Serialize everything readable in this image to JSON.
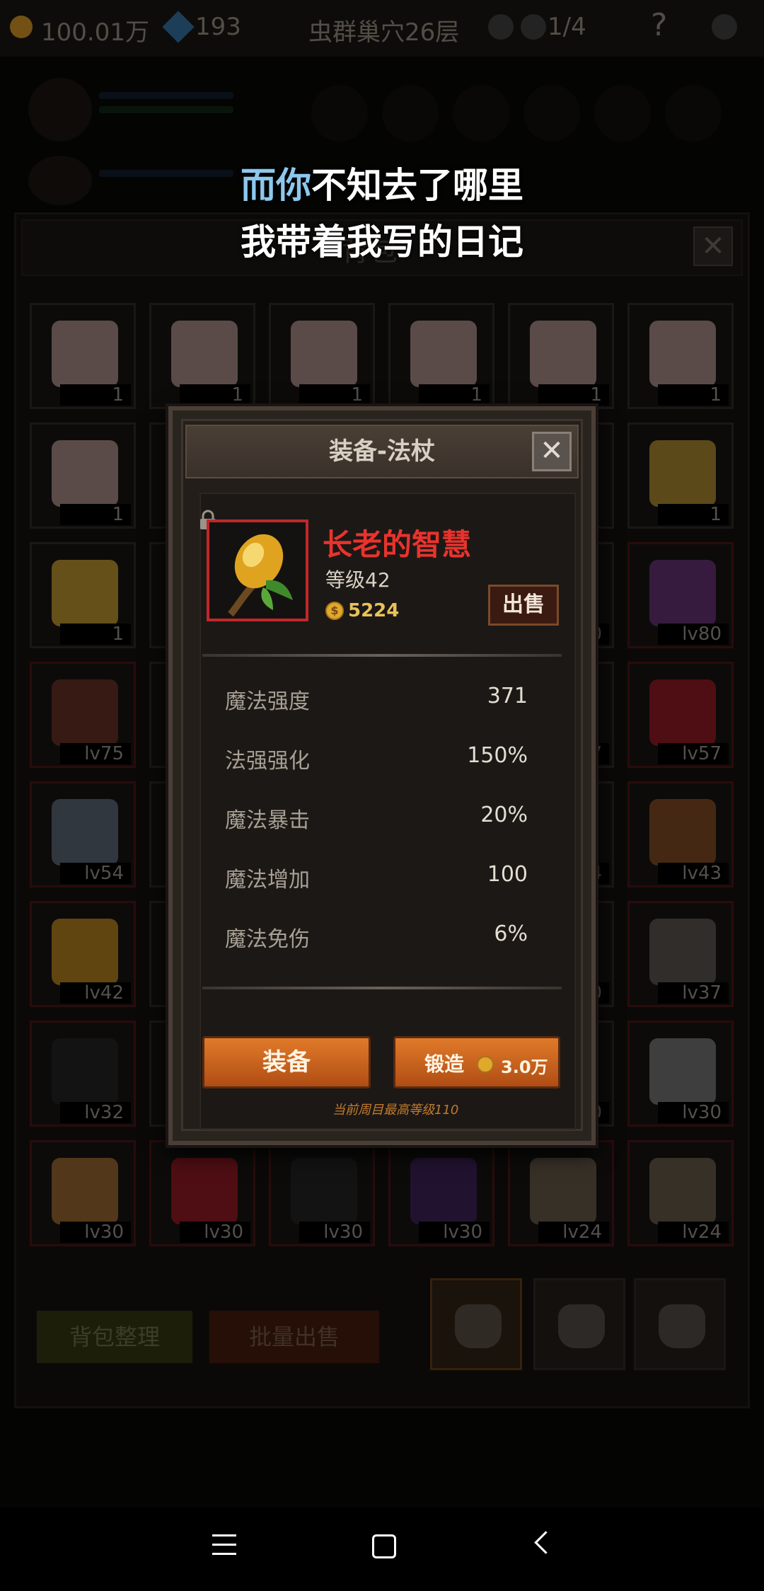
{
  "hud": {
    "gold": "100.01万",
    "gems": "193",
    "location": "虫群巢穴26层",
    "kills": "1/4",
    "help": "?"
  },
  "lyrics": {
    "line1_highlight": "而你",
    "line1_rest": "不知去了哪里",
    "line2": "我带着我写的日记"
  },
  "bag": {
    "title": "背包",
    "close": "✕",
    "rows": [
      [
        {
          "label": "1",
          "kind": "cake"
        },
        {
          "label": "1",
          "kind": "cake"
        },
        {
          "label": "1",
          "kind": "cake"
        },
        {
          "label": "1",
          "kind": "cake"
        },
        {
          "label": "1",
          "kind": "cake"
        },
        {
          "label": "1",
          "kind": "cake"
        }
      ],
      [
        {
          "label": "1",
          "kind": "cake"
        },
        {
          "label": "",
          "kind": "hidden"
        },
        {
          "label": "",
          "kind": "hidden"
        },
        {
          "label": "",
          "kind": "hidden"
        },
        {
          "label": "",
          "kind": "hidden"
        },
        {
          "label": "1",
          "kind": "beer"
        }
      ],
      [
        {
          "label": "1",
          "kind": "cheese"
        },
        {
          "label": "",
          "kind": "hidden"
        },
        {
          "label": "",
          "kind": "hidden"
        },
        {
          "label": "",
          "kind": "hidden"
        },
        {
          "label": "0",
          "kind": "hidden"
        },
        {
          "label": "lv80",
          "kind": "gun"
        }
      ],
      [
        {
          "label": "lv75",
          "kind": "axe"
        },
        {
          "label": "",
          "kind": "hidden"
        },
        {
          "label": "",
          "kind": "hidden"
        },
        {
          "label": "",
          "kind": "hidden"
        },
        {
          "label": "7",
          "kind": "hidden"
        },
        {
          "label": "lv57",
          "kind": "amulet"
        }
      ],
      [
        {
          "label": "lv54",
          "kind": "box"
        },
        {
          "label": "",
          "kind": "hidden"
        },
        {
          "label": "",
          "kind": "hidden"
        },
        {
          "label": "",
          "kind": "hidden"
        },
        {
          "label": "4",
          "kind": "hidden"
        },
        {
          "label": "lv43",
          "kind": "trident"
        }
      ],
      [
        {
          "label": "lv42",
          "kind": "staff"
        },
        {
          "label": "",
          "kind": "hidden"
        },
        {
          "label": "",
          "kind": "hidden"
        },
        {
          "label": "",
          "kind": "hidden"
        },
        {
          "label": "0",
          "kind": "hidden"
        },
        {
          "label": "lv37",
          "kind": "hammer"
        }
      ],
      [
        {
          "label": "lv32",
          "kind": "armor"
        },
        {
          "label": "",
          "kind": "hidden"
        },
        {
          "label": "",
          "kind": "hidden"
        },
        {
          "label": "",
          "kind": "hidden"
        },
        {
          "label": "0",
          "kind": "hidden"
        },
        {
          "label": "lv30",
          "kind": "blade"
        }
      ],
      [
        {
          "label": "lv30",
          "kind": "horn"
        },
        {
          "label": "lv30",
          "kind": "amulet"
        },
        {
          "label": "lv30",
          "kind": "armor"
        },
        {
          "label": "lv30",
          "kind": "cloak"
        },
        {
          "label": "lv24",
          "kind": "helm"
        },
        {
          "label": "lv24",
          "kind": "helm"
        }
      ]
    ],
    "sort_button": "背包整理",
    "bulk_sell_button": "批量出售"
  },
  "dialog": {
    "title": "装备-法杖",
    "close": "✕",
    "item_name": "长老的智慧",
    "item_level": "等级42",
    "price_coin_symbol": "$",
    "price": "5224",
    "sell_button": "出售",
    "stats": [
      {
        "label": "魔法强度",
        "value": "371"
      },
      {
        "label": "法强强化",
        "value": "150%"
      },
      {
        "label": "魔法暴击",
        "value": "20%"
      },
      {
        "label": "魔法增加",
        "value": "100"
      },
      {
        "label": "魔法免伤",
        "value": "6%"
      }
    ],
    "equip_button": "装备",
    "forge_button": "锻造",
    "forge_cost": "3.0万",
    "max_level_note": "当前周目最高等级110"
  },
  "colors": {
    "item_name": "#e8332d",
    "button_orange": "#d0651f",
    "gold_text": "#e8c25a",
    "lyric_highlight": "#8cc8ee"
  },
  "icons": {
    "lock": "lock-icon",
    "coin": "coin-icon",
    "close": "close-icon",
    "nav_menu": "menu-icon",
    "nav_home": "home-icon",
    "nav_back": "back-icon"
  }
}
